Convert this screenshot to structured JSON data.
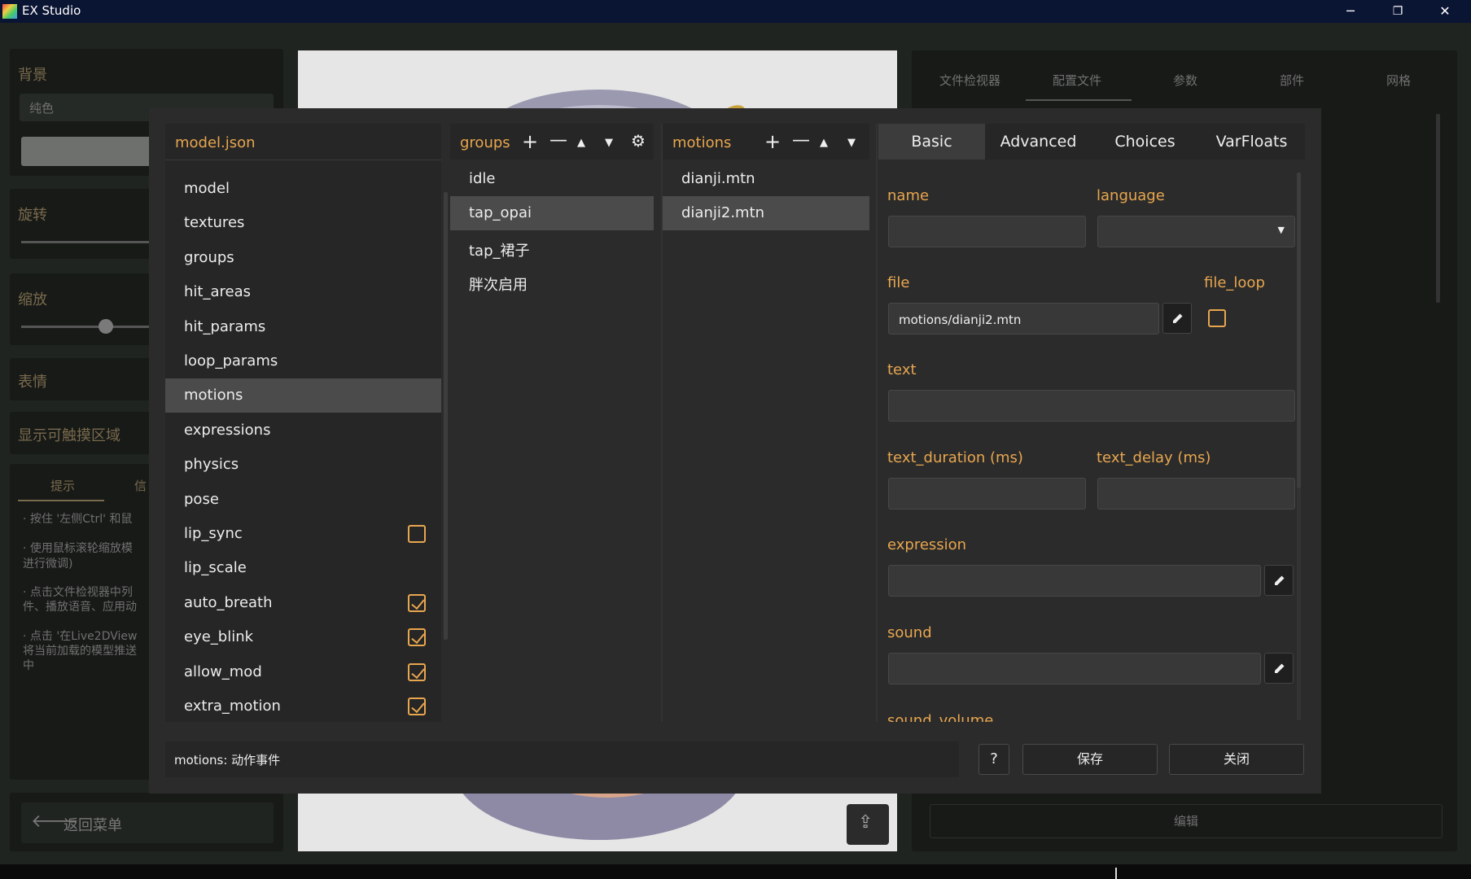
{
  "window": {
    "title": "EX Studio",
    "minimize": "─",
    "maximize": "❐",
    "close": "✕"
  },
  "background_app": {
    "left_panel": {
      "background_label": "背景",
      "background_select": "纯色",
      "rotate_label": "旋转",
      "scale_label": "缩放",
      "expression_label": "表情",
      "show_touch_area": "显示可触摸区域",
      "tip_tabs": [
        "提示",
        "信"
      ],
      "tips": [
        "· 按住 '左侧Ctrl' 和鼠",
        "· 使用鼠标滚轮缩放模",
        "进行微调)",
        "· 点击文件检视器中列",
        "件、播放语音、应用动",
        "· 点击 '在Live2DView",
        "将当前加载的模型推送",
        "中"
      ],
      "back_button": "返回菜单"
    },
    "right_panel": {
      "tabs": [
        "文件检视器",
        "配置文件",
        "参数",
        "部件",
        "网格"
      ],
      "edit_button": "编辑"
    }
  },
  "dialog": {
    "tree_header": "model.json",
    "tree_items": [
      {
        "label": "model",
        "checkbox": null
      },
      {
        "label": "textures",
        "checkbox": null
      },
      {
        "label": "groups",
        "checkbox": null
      },
      {
        "label": "hit_areas",
        "checkbox": null
      },
      {
        "label": "hit_params",
        "checkbox": null
      },
      {
        "label": "loop_params",
        "checkbox": null
      },
      {
        "label": "motions",
        "checkbox": null,
        "selected": true
      },
      {
        "label": "expressions",
        "checkbox": null
      },
      {
        "label": "physics",
        "checkbox": null
      },
      {
        "label": "pose",
        "checkbox": null
      },
      {
        "label": "lip_sync",
        "checkbox": false
      },
      {
        "label": "lip_scale",
        "checkbox": null
      },
      {
        "label": "auto_breath",
        "checkbox": true
      },
      {
        "label": "eye_blink",
        "checkbox": true
      },
      {
        "label": "allow_mod",
        "checkbox": true
      },
      {
        "label": "extra_motion",
        "checkbox": true
      }
    ],
    "groups_header": "groups",
    "groups": [
      "idle",
      "tap_opai",
      "tap_裙子",
      "胖次启用"
    ],
    "groups_selected": 1,
    "motions_header": "motions",
    "motions": [
      "dianji.mtn",
      "dianji2.mtn"
    ],
    "motions_selected": 1,
    "tabs": [
      "Basic",
      "Advanced",
      "Choices",
      "VarFloats"
    ],
    "form": {
      "name_label": "name",
      "language_label": "language",
      "file_label": "file",
      "file_value": "motions/dianji2.mtn",
      "file_loop_label": "file_loop",
      "text_label": "text",
      "text_duration_label": "text_duration (ms)",
      "text_delay_label": "text_delay (ms)",
      "expression_label": "expression",
      "sound_label": "sound",
      "sound_volume_label": "sound_volume"
    },
    "status_text": "motions: 动作事件",
    "help_button": "?",
    "save_button": "保存",
    "close_button": "关闭"
  },
  "colors": {
    "accent": "#e8a64f",
    "dialog_bg": "#2b2b2b",
    "selected": "#4b4b4b",
    "titlebar": "#0a1433"
  }
}
